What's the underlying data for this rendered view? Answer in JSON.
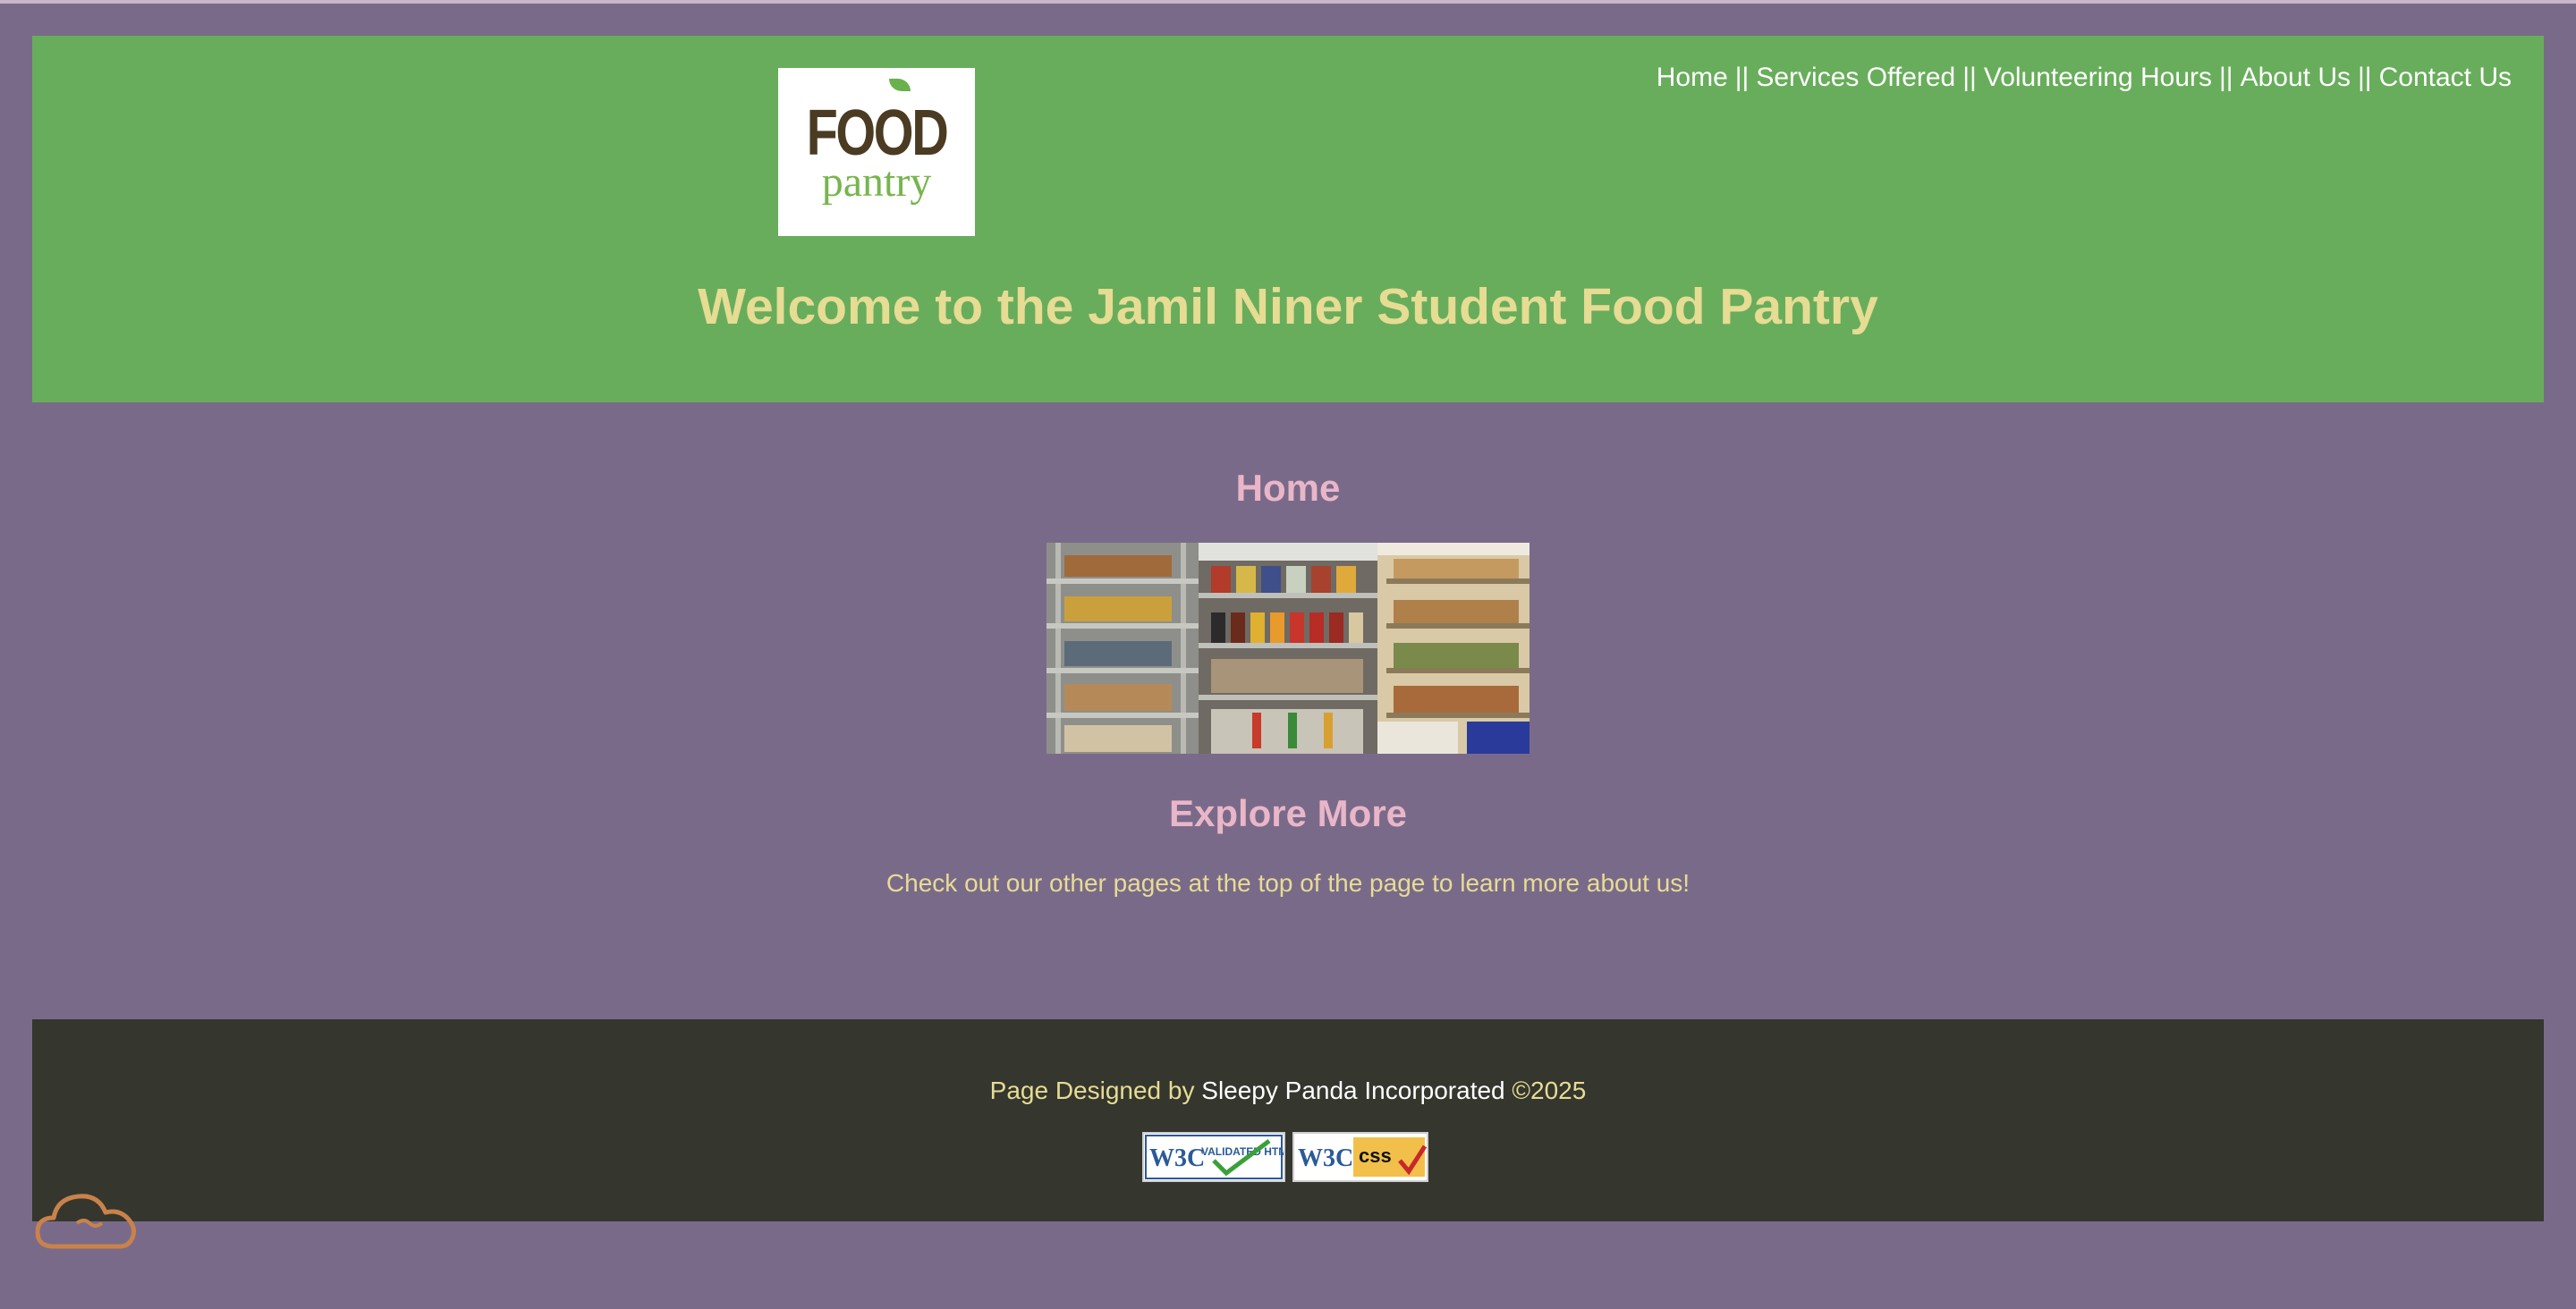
{
  "header": {
    "logo": {
      "line1": "FOOD",
      "line2": "pantry"
    },
    "title": "Welcome to the Jamil Niner Student Food Pantry",
    "nav": [
      {
        "label": "Home"
      },
      {
        "label": "Services Offered"
      },
      {
        "label": "Volunteering Hours"
      },
      {
        "label": "About Us"
      },
      {
        "label": "Contact Us"
      }
    ],
    "nav_separator": "||"
  },
  "main": {
    "title": "Home",
    "hero_image": "pantry-shelves-photo",
    "explore_title": "Explore More",
    "explore_text": "Check out our other pages at the top of the page to learn more about us!"
  },
  "footer": {
    "credit_prefix": "Page Designed by",
    "credit_name": "Sleepy Panda Incorporated",
    "credit_year": "©2025",
    "badges": {
      "html": {
        "w3c": "W3C",
        "text": "VALIDATED HTML 5"
      },
      "css": {
        "w3c": "W3C",
        "text": "css"
      }
    }
  },
  "colors": {
    "page_bg": "#7a6a8a",
    "header_bg": "#68ad5b",
    "title": "#e6dc94",
    "heading": "#e9b6c8",
    "footer_bg": "#35362e"
  }
}
